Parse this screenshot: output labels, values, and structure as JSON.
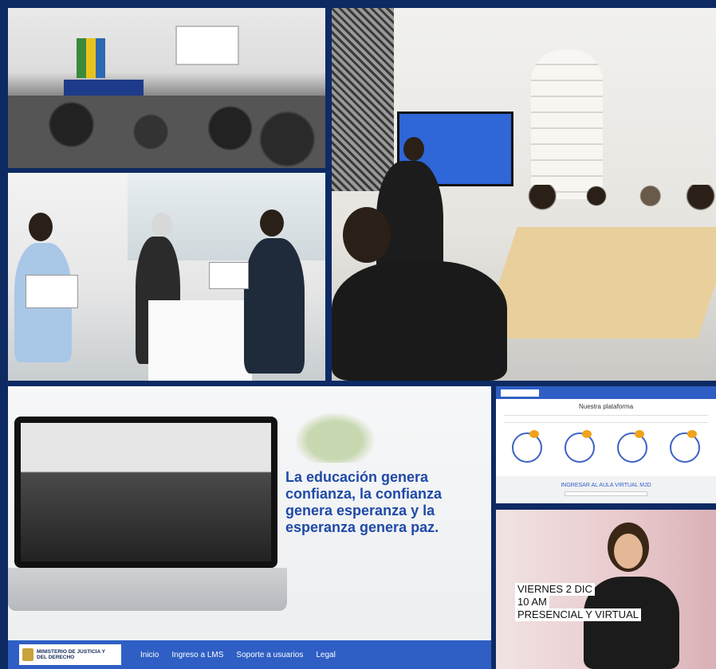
{
  "banner": {
    "quote_lines": [
      "La educación genera",
      "confianza, la confianza",
      "genera esperanza y la",
      "esperanza genera paz."
    ],
    "logo_lines": [
      "MINISTERIO DE JUSTICIA Y",
      "DEL DERECHO"
    ],
    "nav": [
      "Inicio",
      "Ingreso a LMS",
      "Soporte a usuarios",
      "Legal"
    ]
  },
  "platform": {
    "title": "Nuestra plataforma",
    "cta": "INGRESAR AL AULA VIRTUAL MJD"
  },
  "video": {
    "caption_lines": [
      "VIERNES 2 DIC",
      "10 AM",
      "PRESENCIAL Y VIRTUAL"
    ]
  },
  "colors": {
    "frame": "#0d2a63",
    "brand_blue": "#2f5fc4",
    "quote_blue": "#1f4aa8",
    "accent_orange": "#f0a21a"
  }
}
